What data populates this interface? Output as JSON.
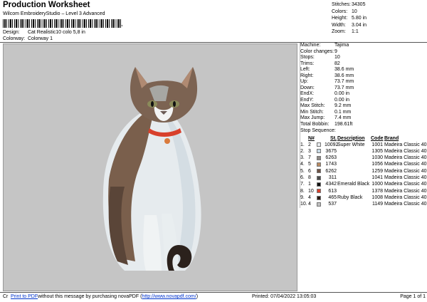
{
  "header": {
    "title": "Production Worksheet",
    "subtitle": "Wilcom EmbroideryStudio – Level 3 Advanced",
    "barcode_tail": ",",
    "design_label": "Design:",
    "design_value": "Cat Realistic10 colo 5,8 in",
    "colorway_label": "Colorway:",
    "colorway_value": "Colorway 1"
  },
  "summary": [
    {
      "k": "Stitches:",
      "v": "34305"
    },
    {
      "k": "Colors:",
      "v": "10"
    },
    {
      "k": "Height:",
      "v": "5.80 in"
    },
    {
      "k": "Width:",
      "v": "3.04 in"
    },
    {
      "k": "Zoom:",
      "v": "1:1"
    }
  ],
  "properties": [
    {
      "k": "Machine:",
      "v": "Tajima"
    },
    {
      "k": "Color changes:",
      "v": "9"
    },
    {
      "k": "Stops:",
      "v": "10"
    },
    {
      "k": "Trims:",
      "v": "82"
    },
    {
      "k": "Left:",
      "v": "38.6 mm"
    },
    {
      "k": "Right:",
      "v": "38.6 mm"
    },
    {
      "k": "Up:",
      "v": "73.7 mm"
    },
    {
      "k": "Down:",
      "v": "73.7 mm"
    },
    {
      "k": "EndX:",
      "v": "0.00 in"
    },
    {
      "k": "EndY:",
      "v": "0.00 in"
    },
    {
      "k": "Max Stitch:",
      "v": "9.2 mm"
    },
    {
      "k": "Min Stitch:",
      "v": "0.1 mm"
    },
    {
      "k": "Max Jump:",
      "v": "7.4 mm"
    },
    {
      "k": "Total Bobbin:",
      "v": "198.61ft"
    }
  ],
  "sequence": {
    "label": "Stop Sequence:",
    "headers": {
      "n": "N#",
      "st": "St.",
      "desc": "Description",
      "code": "Code",
      "brand": "Brand"
    },
    "rows": [
      {
        "n": "1.",
        "hash": "2",
        "color": "#e9ecef",
        "st": "10092",
        "desc": "Super White",
        "code": "1001",
        "brand": "Madeira Classic 40"
      },
      {
        "n": "2.",
        "hash": "3",
        "color": "#c7d9e4",
        "st": "3675",
        "desc": "",
        "code": "1305",
        "brand": "Madeira Classic 40"
      },
      {
        "n": "3.",
        "hash": "7",
        "color": "#8f8a86",
        "st": "6263",
        "desc": "",
        "code": "1030",
        "brand": "Madeira Classic 40"
      },
      {
        "n": "4.",
        "hash": "5",
        "color": "#b88a62",
        "st": "1743",
        "desc": "",
        "code": "1056",
        "brand": "Madeira Classic 40"
      },
      {
        "n": "5.",
        "hash": "6",
        "color": "#6e5346",
        "st": "6262",
        "desc": "",
        "code": "1259",
        "brand": "Madeira Classic 40"
      },
      {
        "n": "6.",
        "hash": "8",
        "color": "#4a4a4a",
        "st": "311",
        "desc": "",
        "code": "1041",
        "brand": "Madeira Classic 40"
      },
      {
        "n": "7.",
        "hash": "1",
        "color": "#111111",
        "st": "4342",
        "desc": "Emerald Black",
        "code": "1000",
        "brand": "Madeira Classic 40"
      },
      {
        "n": "8.",
        "hash": "10",
        "color": "#d8402c",
        "st": "613",
        "desc": "",
        "code": "1378",
        "brand": "Madeira Classic 40"
      },
      {
        "n": "9.",
        "hash": "4",
        "color": "#2a1a12",
        "st": "465",
        "desc": "Ruby Black",
        "code": "1008",
        "brand": "Madeira Classic 40"
      },
      {
        "n": "10.",
        "hash": "4",
        "color": "#bfbfbf",
        "st": "537",
        "desc": "",
        "code": "1149",
        "brand": "Madeira Classic 40"
      }
    ]
  },
  "footer": {
    "cr": "Cr",
    "print_link": "Print to PDF",
    "message": " without this message by purchasing novaPDF (",
    "url": "http://www.novapdf.com/",
    "close": ")",
    "printed": "Printed: 07/04/2022 13:05:03",
    "page": "Page 1 of 1"
  },
  "colors": {
    "panel_bg": "#c5c5c5",
    "link": "#0033cc"
  }
}
